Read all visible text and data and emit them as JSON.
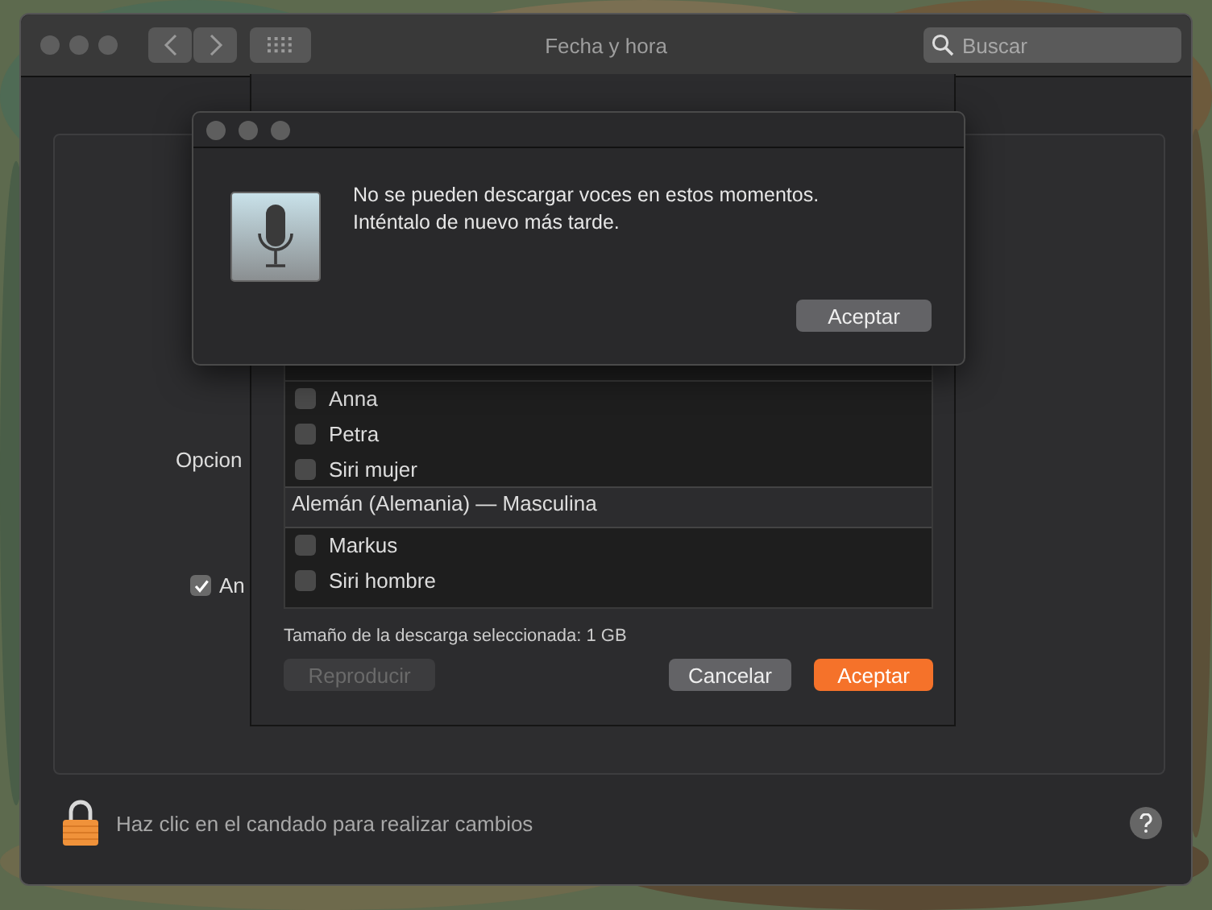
{
  "window": {
    "title": "Fecha y hora",
    "search": {
      "placeholder": "Buscar"
    }
  },
  "panel": {
    "label": "Opcion",
    "checkbox": {
      "label": "An",
      "checked": true
    }
  },
  "sheet": {
    "voices": [
      {
        "kind": "voice",
        "name": "Anna",
        "checked": false
      },
      {
        "kind": "voice",
        "name": "Petra",
        "checked": false
      },
      {
        "kind": "voice",
        "name": "Siri mujer",
        "checked": false
      },
      {
        "kind": "group",
        "name": "Alemán (Alemania) — Masculina"
      },
      {
        "kind": "voice",
        "name": "Markus",
        "checked": false
      },
      {
        "kind": "voice",
        "name": "Siri hombre",
        "checked": false
      }
    ],
    "download_size": "Tamaño de la descarga seleccionada: 1 GB",
    "buttons": [
      {
        "label": "Reproducir",
        "disabled": true,
        "default": false
      },
      {
        "label": "Cancelar",
        "disabled": false,
        "default": false
      },
      {
        "label": "Aceptar",
        "disabled": false,
        "default": true
      }
    ]
  },
  "alert": {
    "message": "No se pueden descargar voces en estos momentos.\nInténtalo de nuevo más tarde.",
    "button": "Aceptar"
  },
  "footer": {
    "lock_text": "Haz clic en el candado para realizar cambios"
  }
}
